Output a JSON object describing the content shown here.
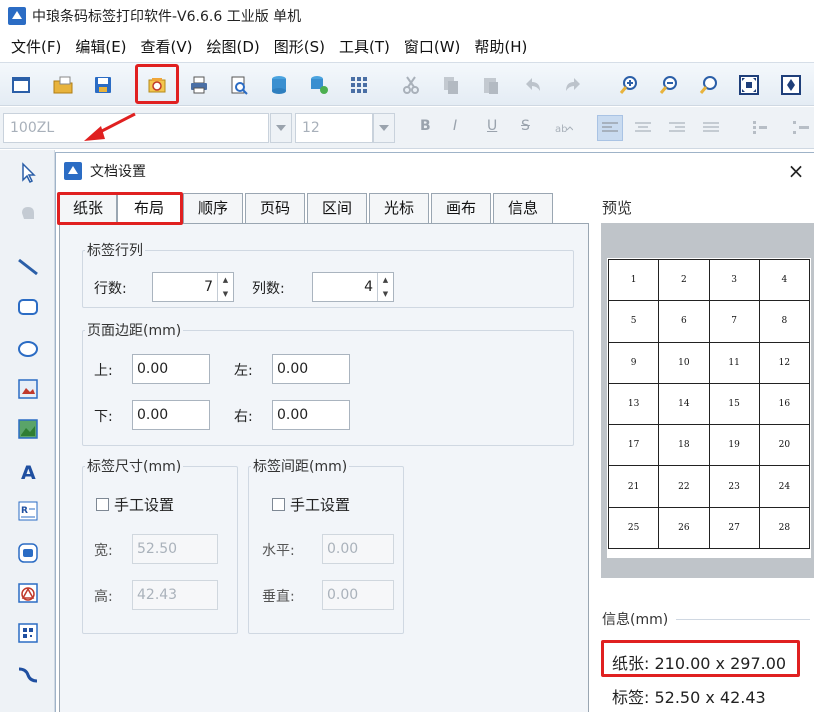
{
  "app": {
    "title": "中琅条码标签打印软件-V6.6.6 工业版 单机"
  },
  "menu": [
    "文件(F)",
    "编辑(E)",
    "查看(V)",
    "绘图(D)",
    "图形(S)",
    "工具(T)",
    "窗口(W)",
    "帮助(H)"
  ],
  "toolbar": {
    "icons": [
      "new-icon",
      "open-icon",
      "save-icon",
      "document-settings-icon",
      "print-icon",
      "print-preview-icon",
      "database-icon",
      "database-settings-icon",
      "grid-icon",
      "cut-icon",
      "copy-icon",
      "paste-icon",
      "undo-icon",
      "redo-icon",
      "zoom-in-icon",
      "zoom-out-icon",
      "zoom-fit-icon",
      "fit-page-icon",
      "fit-width-icon"
    ]
  },
  "format_bar": {
    "font_name": "100ZL",
    "font_size": "12",
    "bold": "B",
    "italic": "I",
    "underline": "U",
    "strike": "S"
  },
  "dialog": {
    "title": "文档设置",
    "close": "×",
    "tabs": [
      "纸张",
      "布局",
      "顺序",
      "页码",
      "区间",
      "光标",
      "画布",
      "信息"
    ],
    "active_tab": "布局",
    "label_grid": {
      "legend": "标签行列",
      "rows_label": "行数:",
      "rows": "7",
      "cols_label": "列数:",
      "cols": "4"
    },
    "margins": {
      "legend": "页面边距(mm)",
      "top_label": "上:",
      "top": "0.00",
      "left_label": "左:",
      "left": "0.00",
      "bottom_label": "下:",
      "bottom": "0.00",
      "right_label": "右:",
      "right": "0.00"
    },
    "label_size": {
      "legend": "标签尺寸(mm)",
      "manual": "手工设置",
      "width_label": "宽:",
      "width": "52.50",
      "height_label": "高:",
      "height": "42.43"
    },
    "label_spacing": {
      "legend": "标签间距(mm)",
      "manual": "手工设置",
      "h_label": "水平:",
      "h": "0.00",
      "v_label": "垂直:",
      "v": "0.00"
    },
    "preview": {
      "label": "预览",
      "cells": [
        "1",
        "2",
        "3",
        "4",
        "5",
        "6",
        "7",
        "8",
        "9",
        "10",
        "11",
        "12",
        "13",
        "14",
        "15",
        "16",
        "17",
        "18",
        "19",
        "20",
        "21",
        "22",
        "23",
        "24",
        "25",
        "26",
        "27",
        "28"
      ]
    },
    "info": {
      "label": "信息(mm)",
      "paper": "纸张: 210.00 x 297.00",
      "label_size": "标签: 52.50 x 42.43"
    }
  },
  "colors": {
    "highlight": "#e02020",
    "accent": "#2b6cc4"
  }
}
